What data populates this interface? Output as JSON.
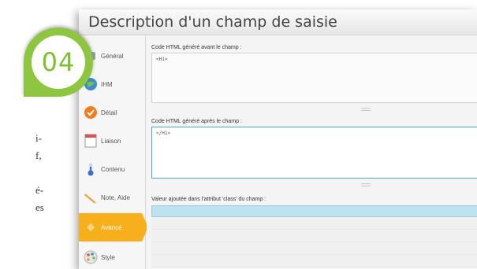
{
  "page_text_fragments": [
    "i-",
    "f,",
    "",
    "é-",
    "es"
  ],
  "step_badge": "04",
  "window": {
    "title": "Description d'un champ de saisie"
  },
  "sidebar": {
    "items": [
      {
        "label": "Général",
        "icon": "general-icon"
      },
      {
        "label": "IHM",
        "icon": "globe-icon"
      },
      {
        "label": "Détail",
        "icon": "detail-icon"
      },
      {
        "label": "Liaison",
        "icon": "liaison-icon"
      },
      {
        "label": "Contenu",
        "icon": "thermometer-icon"
      },
      {
        "label": "Note, Aide",
        "icon": "pencil-icon"
      },
      {
        "label": "Avancé",
        "icon": "advanced-icon",
        "active": true
      },
      {
        "label": "Style",
        "icon": "palette-icon"
      }
    ]
  },
  "form": {
    "before_label": "Code HTML généré avant le champ :",
    "before_value": "<H1>",
    "after_label": "Code HTML généré après le champ :",
    "after_value": "</H1>",
    "class_label": "Valeur ajoutée dans l'attribut 'class' du champ :",
    "class_value": ""
  },
  "colors": {
    "accent": "#f7b01b",
    "badge": "#8ec63f",
    "focus": "#49a8c7",
    "selection": "#bfe2f1"
  }
}
